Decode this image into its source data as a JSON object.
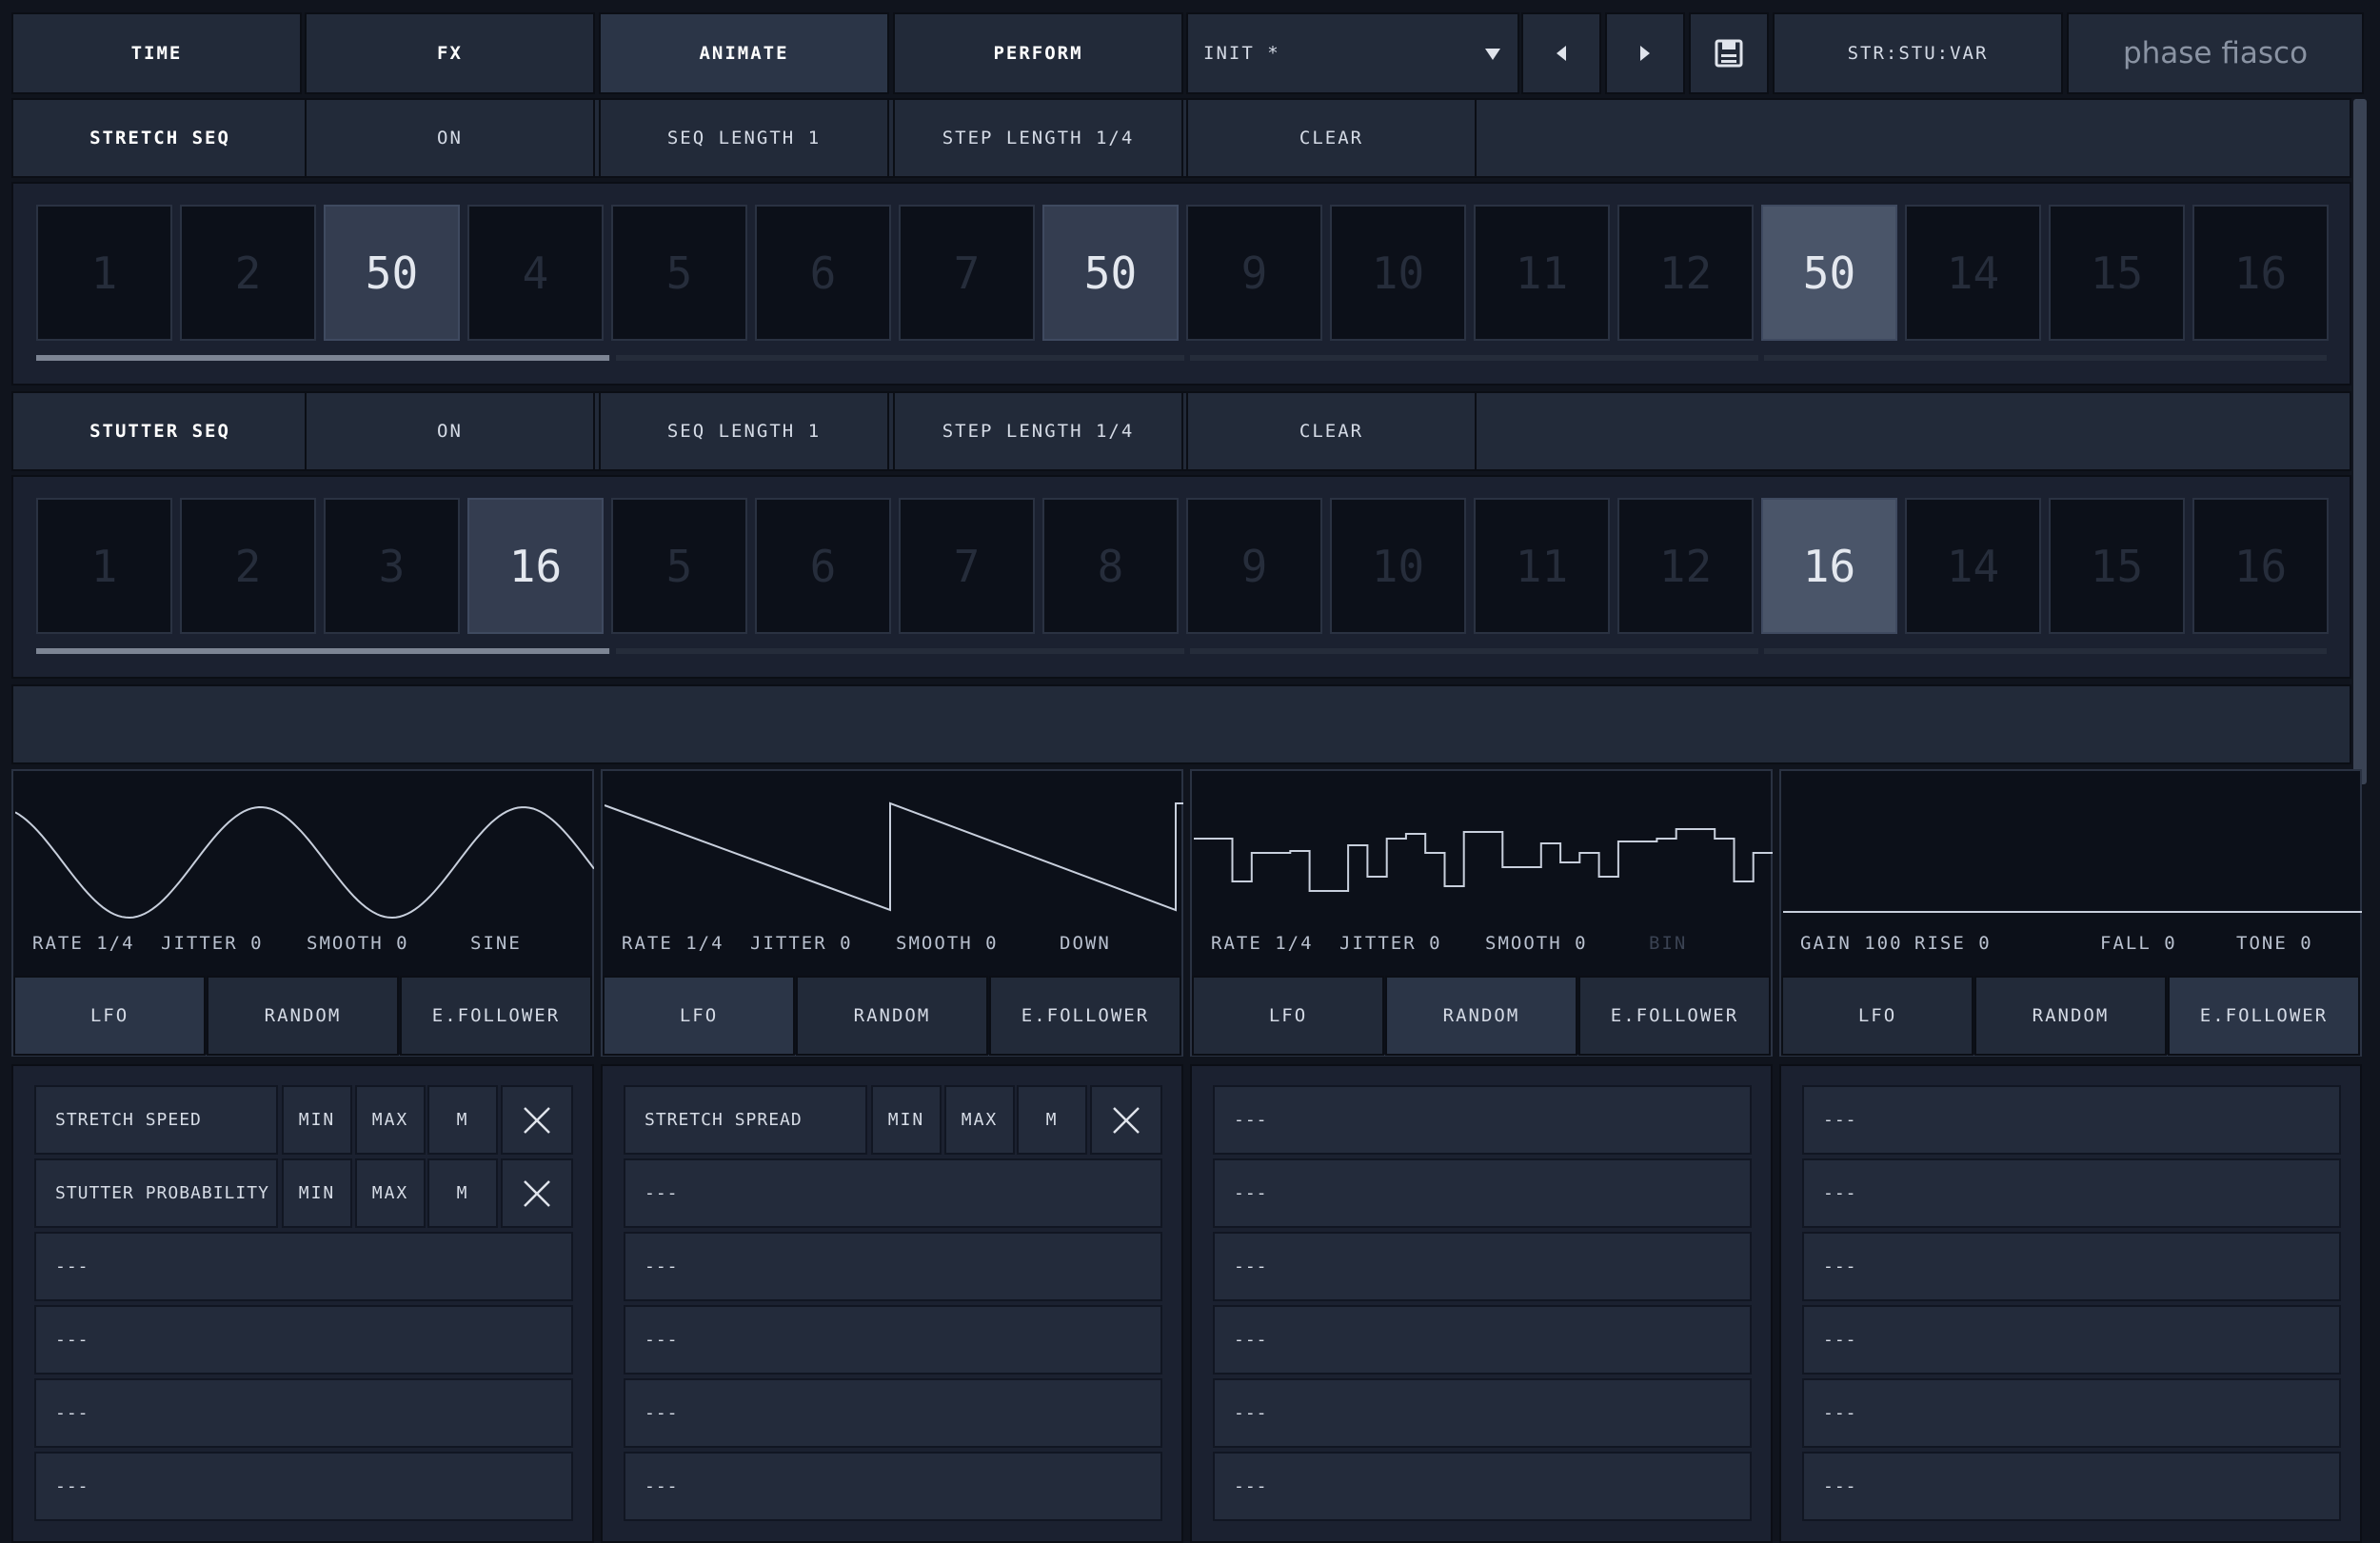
{
  "header": {
    "tabs": [
      {
        "label": "TIME"
      },
      {
        "label": "FX"
      },
      {
        "label": "ANIMATE"
      },
      {
        "label": "PERFORM"
      }
    ],
    "preset": "INIT *",
    "mode": "STR:STU:VAR",
    "logo": "phase fiasco"
  },
  "stretch_seq": {
    "title": "STRETCH SEQ",
    "state": "ON",
    "seq_length": "SEQ LENGTH 1",
    "step_length": "STEP LENGTH 1/4",
    "clear": "CLEAR",
    "steps": [
      "1",
      "2",
      "50",
      "4",
      "5",
      "6",
      "7",
      "50",
      "9",
      "10",
      "11",
      "12",
      "50",
      "14",
      "15",
      "16"
    ],
    "progress": 0.25
  },
  "stutter_seq": {
    "title": "STUTTER SEQ",
    "state": "ON",
    "seq_length": "SEQ LENGTH 1",
    "step_length": "STEP LENGTH 1/4",
    "clear": "CLEAR",
    "steps": [
      "1",
      "2",
      "3",
      "16",
      "5",
      "6",
      "7",
      "8",
      "9",
      "10",
      "11",
      "12",
      "16",
      "14",
      "15",
      "16"
    ],
    "progress": 0.25
  },
  "modulators": [
    {
      "params": [
        "RATE 1/4",
        "JITTER 0",
        "SMOOTH 0",
        "SINE"
      ],
      "types": [
        "LFO",
        "RANDOM",
        "E.FOLLOWER"
      ],
      "active_type": "LFO",
      "slots": [
        {
          "label": "STRETCH SPEED",
          "min": "MIN",
          "max": "MAX",
          "m": "M"
        },
        {
          "label": "STUTTER PROBABILITY",
          "min": "MIN",
          "max": "MAX",
          "m": "M"
        },
        {
          "label": "---"
        },
        {
          "label": "---"
        },
        {
          "label": "---"
        },
        {
          "label": "---"
        }
      ]
    },
    {
      "params": [
        "RATE 1/4",
        "JITTER 0",
        "SMOOTH 0",
        "DOWN"
      ],
      "types": [
        "LFO",
        "RANDOM",
        "E.FOLLOWER"
      ],
      "active_type": "LFO",
      "slots": [
        {
          "label": "STRETCH SPREAD",
          "min": "MIN",
          "max": "MAX",
          "m": "M"
        },
        {
          "label": "---"
        },
        {
          "label": "---"
        },
        {
          "label": "---"
        },
        {
          "label": "---"
        },
        {
          "label": "---"
        }
      ]
    },
    {
      "params": [
        "RATE 1/4",
        "JITTER 0",
        "SMOOTH 0",
        "BIN"
      ],
      "types": [
        "LFO",
        "RANDOM",
        "E.FOLLOWER"
      ],
      "active_type": "RANDOM",
      "slots": [
        {
          "label": "---"
        },
        {
          "label": "---"
        },
        {
          "label": "---"
        },
        {
          "label": "---"
        },
        {
          "label": "---"
        },
        {
          "label": "---"
        }
      ]
    },
    {
      "params": [
        "GAIN 100",
        "RISE 0",
        "FALL 0",
        "TONE 0"
      ],
      "types": [
        "LFO",
        "RANDOM",
        "E.FOLLOWER"
      ],
      "active_type": "E.FOLLOWER",
      "slots": [
        {
          "label": "---"
        },
        {
          "label": "---"
        },
        {
          "label": "---"
        },
        {
          "label": "---"
        },
        {
          "label": "---"
        },
        {
          "label": "---"
        }
      ]
    }
  ]
}
